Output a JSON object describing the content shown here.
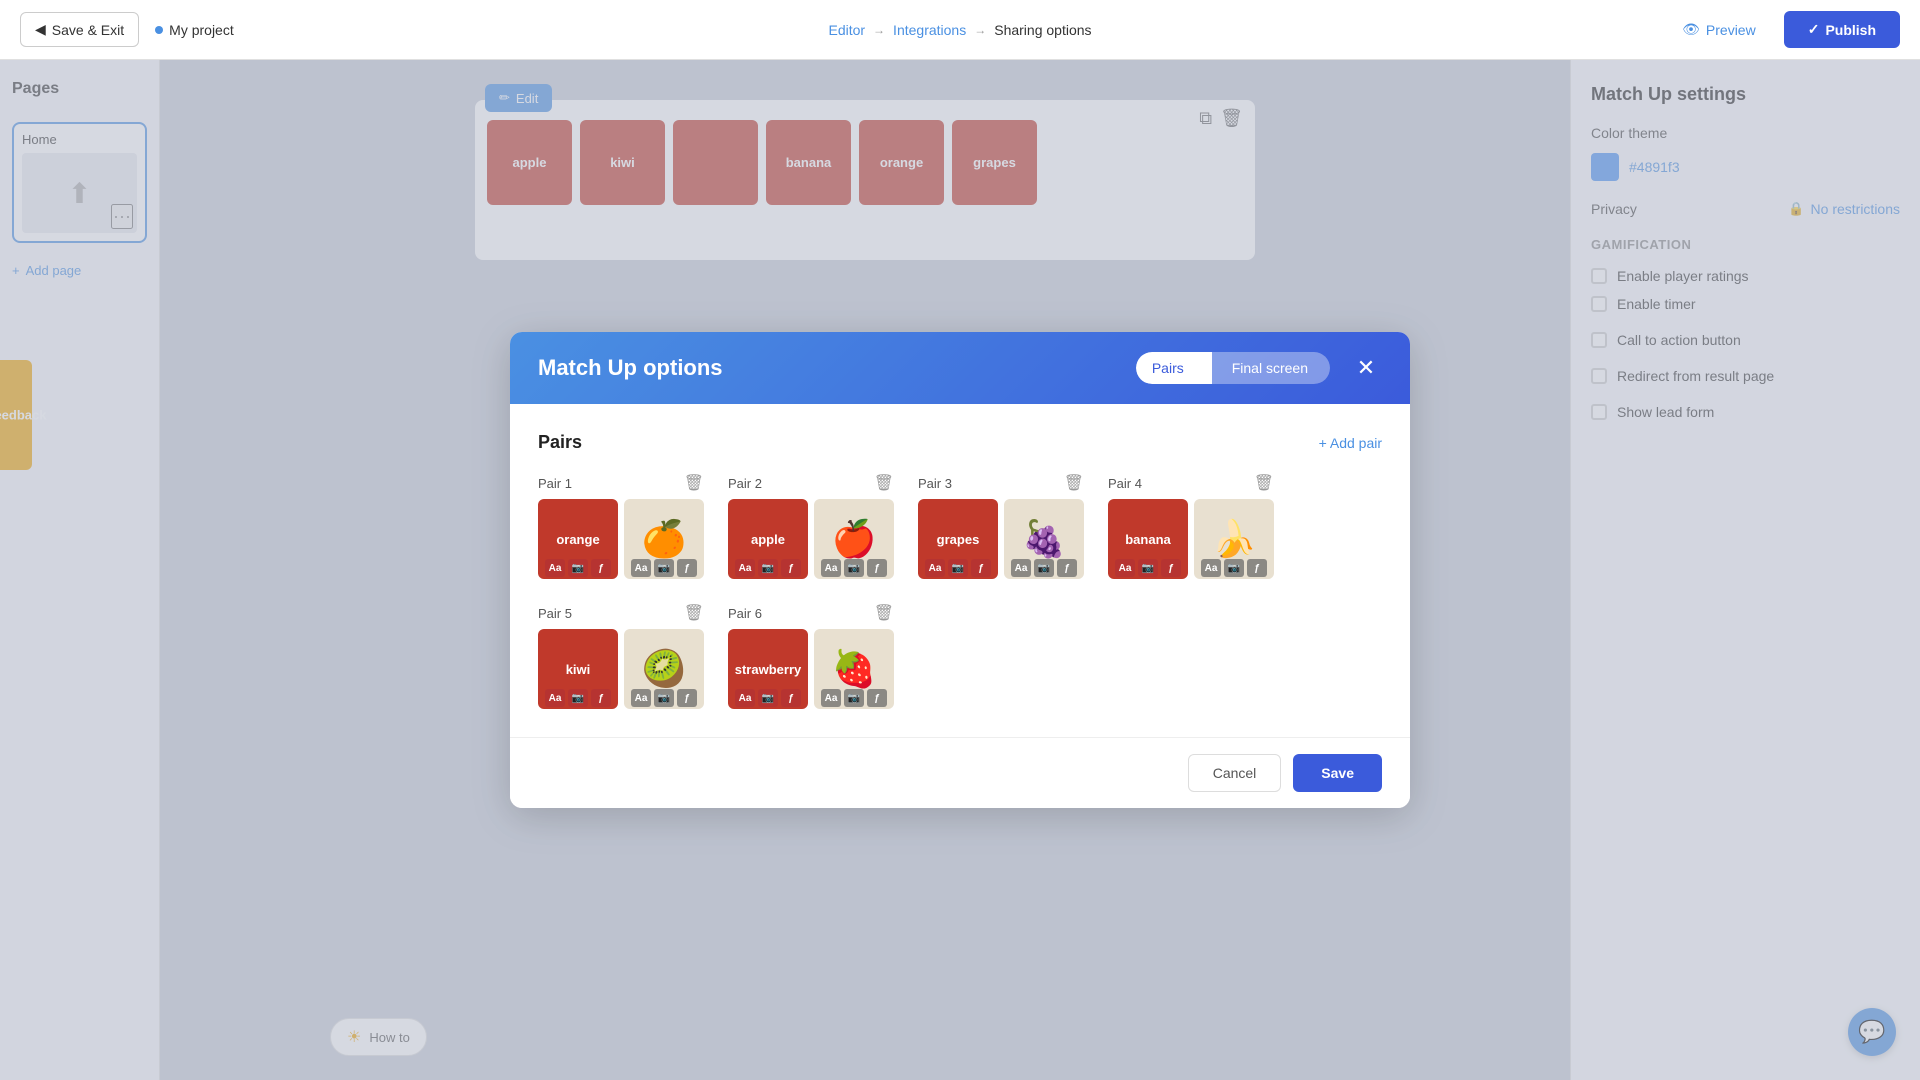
{
  "topNav": {
    "saveExitLabel": "Save & Exit",
    "projectName": "My project",
    "editorLabel": "Editor",
    "integrationsLabel": "Integrations",
    "sharingLabel": "Sharing options",
    "previewLabel": "Preview",
    "publishLabel": "Publish"
  },
  "sidebar": {
    "title": "Pages",
    "homeLabel": "Home",
    "addPageLabel": "Add page"
  },
  "rightPanel": {
    "title": "Match Up settings",
    "colorThemeLabel": "Color theme",
    "colorHex": "#4891f3",
    "privacyLabel": "Privacy",
    "privacyValue": "No restrictions",
    "gamificationLabel": "Gamification",
    "enableRatingsLabel": "Enable player ratings",
    "enableTimerLabel": "Enable timer",
    "callToActionLabel": "Call to action button",
    "redirectLabel": "Redirect from result page",
    "leadFormLabel": "Show lead form"
  },
  "modal": {
    "title": "Match Up options",
    "tab1": "Pairs",
    "tab2": "Final screen",
    "addPairLabel": "+ Add pair",
    "pairsTitle": "Pairs",
    "pairs": [
      {
        "label": "Pair 1",
        "text": "orange",
        "emoji": "🍊",
        "bgColor": "#c0392b"
      },
      {
        "label": "Pair 2",
        "text": "apple",
        "emoji": "🍎",
        "bgColor": "#c0392b"
      },
      {
        "label": "Pair 3",
        "text": "grapes",
        "emoji": "🍇",
        "bgColor": "#c0392b"
      },
      {
        "label": "Pair 4",
        "text": "banana",
        "emoji": "🍌",
        "bgColor": "#c0392b"
      },
      {
        "label": "Pair 5",
        "text": "kiwi",
        "emoji": "🥝",
        "bgColor": "#c0392b"
      },
      {
        "label": "Pair 6",
        "text": "strawberry",
        "emoji": "🍓",
        "bgColor": "#c0392b"
      }
    ],
    "cancelLabel": "Cancel",
    "saveLabel": "Save"
  },
  "feedback": {
    "label": "Feedback"
  },
  "howTo": {
    "label": "How to"
  },
  "colors": {
    "accent": "#4a90e2",
    "publish": "#3b5bdb",
    "feedbackTab": "#f0a500",
    "pairCardBg": "#c0392b"
  }
}
